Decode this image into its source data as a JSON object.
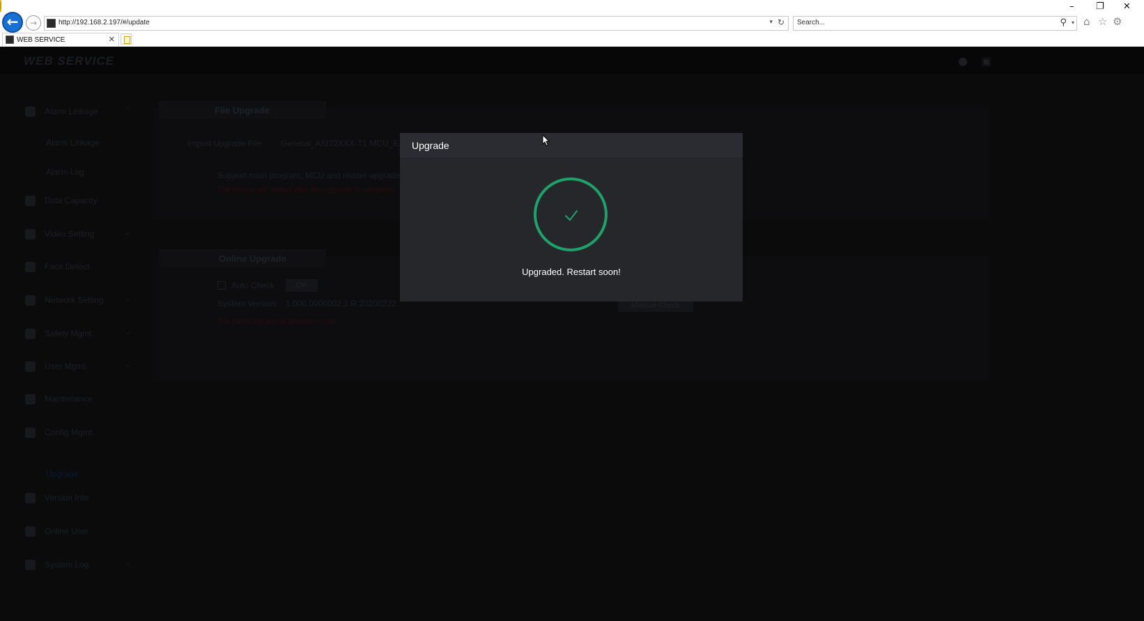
{
  "browser": {
    "url": "http://192.168.2.197/#/update",
    "search_placeholder": "Search...",
    "tab_title": "WEB SERVICE",
    "icons": {
      "back": "arrow-left-icon",
      "forward": "arrow-right-icon",
      "refresh": "refresh-icon",
      "search": "search-icon",
      "home": "home-icon",
      "favorites": "star-icon",
      "settings": "gear-icon",
      "feedback": "smiley-icon"
    }
  },
  "app": {
    "logo": "WEB SERVICE",
    "sidebar": {
      "items": [
        {
          "label": "Alarm Linkage",
          "icon": "alarm-icon",
          "expandable": true
        },
        {
          "label": "Data Capacity",
          "icon": "pie-chart-icon",
          "expandable": false
        },
        {
          "label": "Video Setting",
          "icon": "video-icon",
          "expandable": true
        },
        {
          "label": "Face Detect",
          "icon": "face-detect-icon",
          "expandable": false
        },
        {
          "label": "Network Setting",
          "icon": "globe-icon",
          "expandable": true
        },
        {
          "label": "Safety Mgmt.",
          "icon": "shield-icon",
          "expandable": true
        },
        {
          "label": "User Mgmt.",
          "icon": "user-card-icon",
          "expandable": true
        },
        {
          "label": "Maintenance",
          "icon": "maintenance-icon",
          "expandable": false
        },
        {
          "label": "Config Mgmt.",
          "icon": "config-icon",
          "expandable": false
        },
        {
          "label": "Version Info",
          "icon": "layers-icon",
          "expandable": false
        },
        {
          "label": "Online User",
          "icon": "online-user-icon",
          "expandable": false
        },
        {
          "label": "System Log",
          "icon": "log-icon",
          "expandable": true
        }
      ],
      "sub_items": [
        "Alarm Linkage",
        "Alarm Log"
      ],
      "active_item": "Upgrade"
    },
    "file_upgrade": {
      "title": "File Upgrade",
      "import_label": "Import Upgrade File",
      "file_name": "General_ASI72XXX-T1 MCU_E...",
      "support_text": "Support main program, MCU and reader upgrade.",
      "warning_text": "The device will restart after the upgrade is complete."
    },
    "online_upgrade": {
      "title": "Online Upgrade",
      "auto_check_label": "Auto Check",
      "ok_label": "OK",
      "system_version_label": "System Version:",
      "system_version_value": "1.000.0000002.1.R.20200222",
      "manual_check_label": "Manual Check",
      "status_text": "The latest version is already in use."
    }
  },
  "modal": {
    "title": "Upgrade",
    "message": "Upgraded. Restart soon!",
    "success_color": "#1fa16a"
  }
}
